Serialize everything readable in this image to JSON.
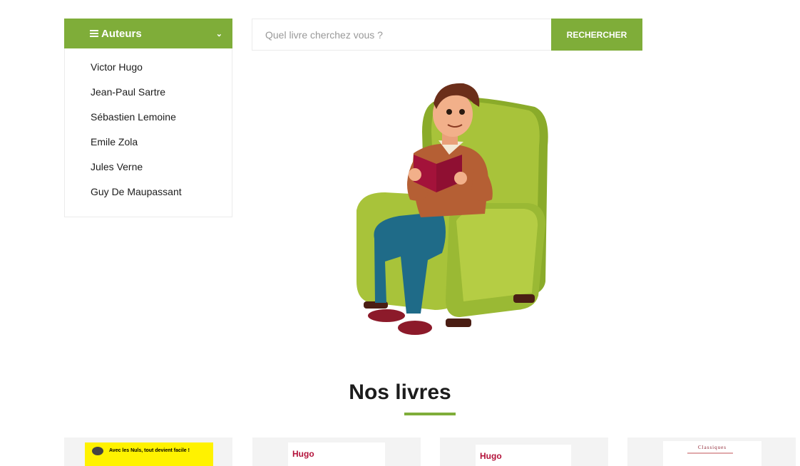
{
  "sidebar": {
    "title": "Auteurs",
    "authors": [
      "Victor Hugo",
      "Jean-Paul Sartre",
      "Sébastien Lemoine",
      "Emile Zola",
      "Jules Verne",
      "Guy De Maupassant"
    ]
  },
  "search": {
    "placeholder": "Quel livre cherchez vous ?",
    "button_label": "RECHERCHER"
  },
  "books_section": {
    "title": "Nos livres",
    "covers": [
      {
        "text": "Avec les Nuls, tout devient facile !"
      },
      {
        "text": "Hugo"
      },
      {
        "text": "Hugo"
      },
      {
        "text": "Classiques"
      }
    ]
  },
  "colors": {
    "accent": "#7fad39",
    "chair": "#a8c33a",
    "book": "#a3123a"
  }
}
